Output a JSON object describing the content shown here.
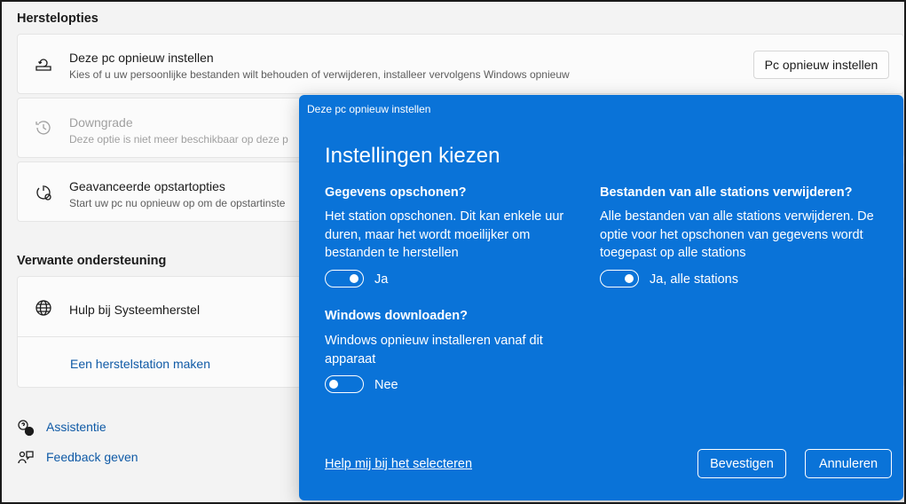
{
  "recovery": {
    "section_title": "Herstelopties",
    "items": [
      {
        "title": "Deze pc opnieuw instellen",
        "subtitle": "Kies of u uw persoonlijke bestanden wilt behouden of verwijderen, installeer vervolgens Windows opnieuw",
        "button": "Pc opnieuw instellen",
        "icon": "reset-pc-icon"
      },
      {
        "title": "Downgrade",
        "subtitle": "Deze optie is niet meer beschikbaar op deze p",
        "icon": "history-icon",
        "disabled": true
      },
      {
        "title": "Geavanceerde opstartopties",
        "subtitle": "Start uw pc nu opnieuw op om de opstartinste",
        "icon": "advanced-startup-icon"
      }
    ]
  },
  "related": {
    "section_title": "Verwante ondersteuning",
    "help_title": "Hulp bij Systeemherstel",
    "help_icon": "globe-icon",
    "link": "Een herstelstation maken"
  },
  "footer": {
    "assist": "Assistentie",
    "feedback": "Feedback geven"
  },
  "dialog": {
    "title": "Deze pc opnieuw instellen",
    "heading": "Instellingen kiezen",
    "options": [
      {
        "heading": "Gegevens opschonen?",
        "description": "Het station opschonen. Dit kan enkele uur duren, maar het wordt moeilijker om bestanden te herstellen",
        "toggle_label": "Ja",
        "on": true
      },
      {
        "heading": "Bestanden van alle stations verwijderen?",
        "description": "Alle bestanden van alle stations verwijderen. De optie voor het opschonen van gegevens wordt toegepast op alle stations",
        "toggle_label": "Ja, alle stations",
        "on": true
      },
      {
        "heading": "Windows downloaden?",
        "description": "Windows opnieuw installeren vanaf dit apparaat",
        "toggle_label": "Nee",
        "on": false
      }
    ],
    "help_link": "Help mij bij het selecteren",
    "confirm": "Bevestigen",
    "cancel": "Annuleren",
    "accent_color": "#0a73d8"
  }
}
